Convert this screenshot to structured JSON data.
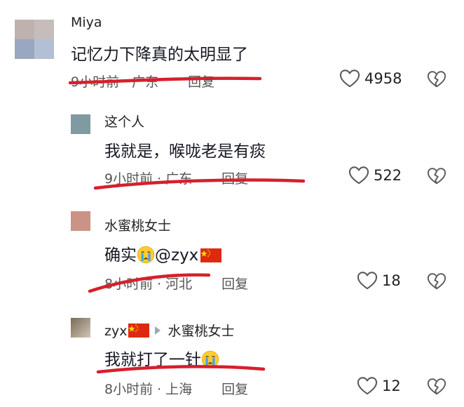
{
  "comments": [
    {
      "author": "Miya",
      "text": "记忆力下降真的太明显了",
      "time": "9小时前",
      "location": "广东",
      "reply": "回复",
      "likes": "4958"
    },
    {
      "author": "这个人",
      "text": "我就是，喉咙老是有痰",
      "time": "9小时前",
      "location": "广东",
      "reply": "回复",
      "likes": "522"
    },
    {
      "author": "水蜜桃女士",
      "text_before": "确实",
      "text_mention": "@zyx",
      "time": "8小时前",
      "location": "河北",
      "reply": "回复",
      "likes": "18"
    },
    {
      "author": "zyx",
      "reply_to": "水蜜桃女士",
      "text": "我就打了一针",
      "time": "8小时前",
      "location": "上海",
      "reply": "回复",
      "likes": "12"
    }
  ],
  "separator": "·",
  "icons": {
    "like": "heart-outline-icon",
    "dislike": "broken-heart-icon",
    "flag": "china-flag-icon",
    "emoji": "crying-face-emoji",
    "reply_arrow": "triangle-right-icon"
  },
  "colors": {
    "annotation_red": "#d6202c",
    "flag_red": "#de2910",
    "flag_star": "#ffde00"
  }
}
